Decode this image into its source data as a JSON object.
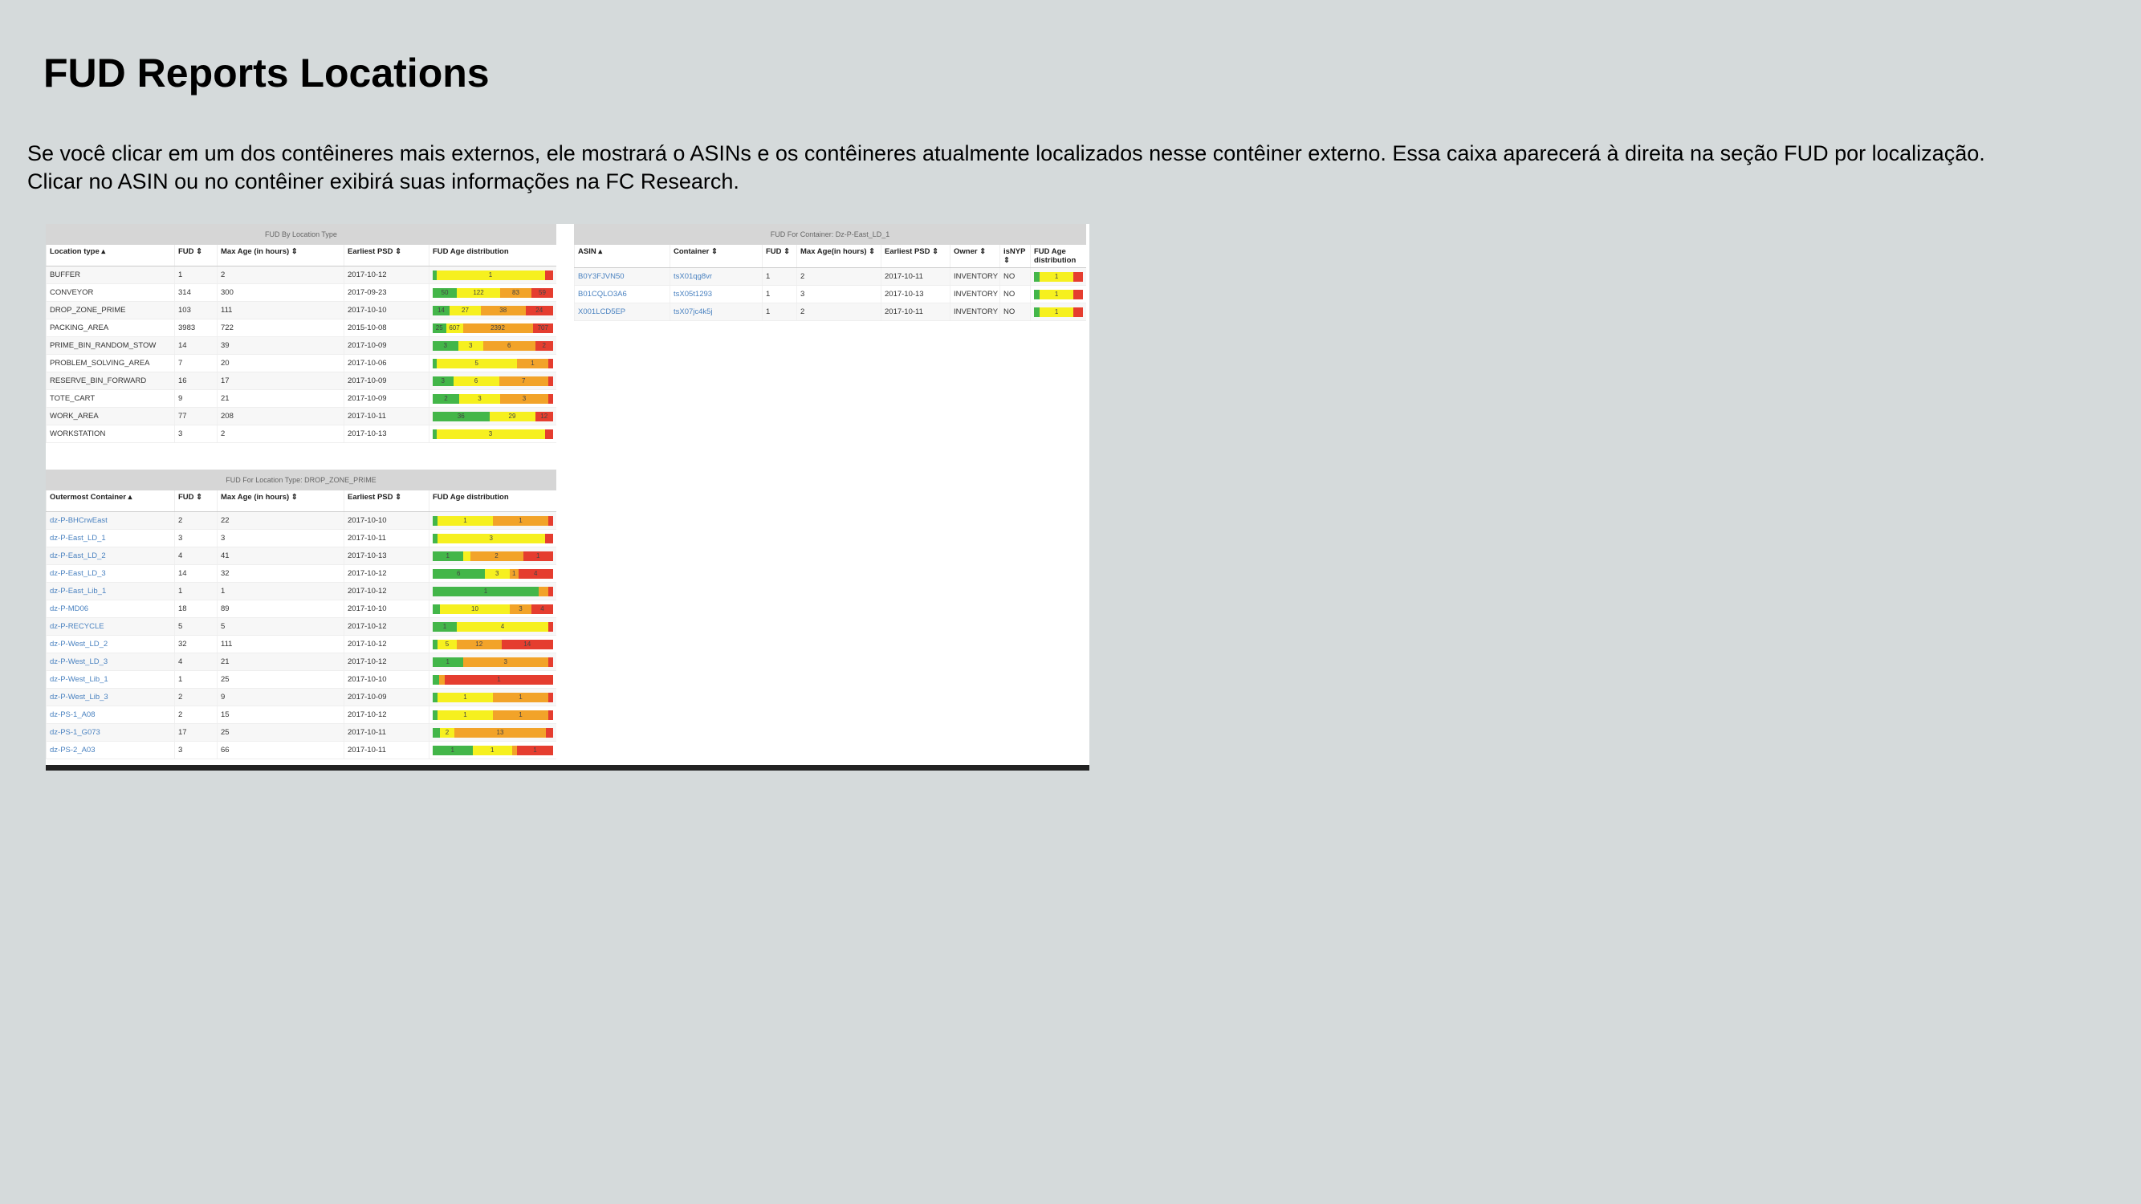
{
  "page": {
    "title": "FUD Reports Locations",
    "description_line1": "Se você clicar em um dos contêineres mais externos, ele mostrará o ASINs e os contêineres atualmente localizados nesse contêiner externo. Essa caixa aparecerá à direita na seção FUD por localização.",
    "description_line2": "Clicar no ASIN ou no contêiner exibirá suas informações na FC Research."
  },
  "colors": {
    "background": "#d5dadb",
    "green": "#43b649",
    "yellow": "#f6f01f",
    "orange": "#f2a329",
    "red": "#e53d2f",
    "link": "#4a82c0"
  },
  "by_location_type": {
    "title": "FUD By Location Type",
    "headers": [
      "Location type ▴",
      "FUD ⇕",
      "Max Age (in hours) ⇕",
      "Earliest PSD ⇕",
      "FUD Age distribution"
    ],
    "rows": [
      {
        "cells": [
          "BUFFER",
          "1",
          "2",
          "2017-10-12"
        ],
        "dist": [
          {
            "c": "g",
            "w": 3,
            "t": ""
          },
          {
            "c": "y",
            "w": 90,
            "t": "1"
          },
          {
            "c": "r",
            "w": 7,
            "t": ""
          }
        ]
      },
      {
        "cells": [
          "CONVEYOR",
          "314",
          "300",
          "2017-09-23"
        ],
        "dist": [
          {
            "c": "g",
            "w": 20,
            "t": "50"
          },
          {
            "c": "y",
            "w": 36,
            "t": "122"
          },
          {
            "c": "o",
            "w": 26,
            "t": "83"
          },
          {
            "c": "r",
            "w": 18,
            "t": "59"
          }
        ]
      },
      {
        "cells": [
          "DROP_ZONE_PRIME",
          "103",
          "111",
          "2017-10-10"
        ],
        "dist": [
          {
            "c": "g",
            "w": 14,
            "t": "14"
          },
          {
            "c": "y",
            "w": 26,
            "t": "27"
          },
          {
            "c": "o",
            "w": 37,
            "t": "38"
          },
          {
            "c": "r",
            "w": 23,
            "t": "24"
          }
        ]
      },
      {
        "cells": [
          "PACKING_AREA",
          "3983",
          "722",
          "2015-10-08"
        ],
        "dist": [
          {
            "c": "g",
            "w": 11,
            "t": "25"
          },
          {
            "c": "y",
            "w": 14,
            "t": "607"
          },
          {
            "c": "o",
            "w": 58,
            "t": "2392"
          },
          {
            "c": "r",
            "w": 17,
            "t": "707"
          }
        ]
      },
      {
        "cells": [
          "PRIME_BIN_RANDOM_STOW",
          "14",
          "39",
          "2017-10-09"
        ],
        "dist": [
          {
            "c": "g",
            "w": 21,
            "t": "3"
          },
          {
            "c": "y",
            "w": 21,
            "t": "3"
          },
          {
            "c": "o",
            "w": 43,
            "t": "6"
          },
          {
            "c": "r",
            "w": 15,
            "t": "2"
          }
        ]
      },
      {
        "cells": [
          "PROBLEM_SOLVING_AREA",
          "7",
          "20",
          "2017-10-06"
        ],
        "dist": [
          {
            "c": "g",
            "w": 3,
            "t": ""
          },
          {
            "c": "y",
            "w": 67,
            "t": "5"
          },
          {
            "c": "o",
            "w": 26,
            "t": "1"
          },
          {
            "c": "r",
            "w": 4,
            "t": ""
          }
        ]
      },
      {
        "cells": [
          "RESERVE_BIN_FORWARD",
          "16",
          "17",
          "2017-10-09"
        ],
        "dist": [
          {
            "c": "g",
            "w": 17,
            "t": "3"
          },
          {
            "c": "y",
            "w": 38,
            "t": "6"
          },
          {
            "c": "o",
            "w": 41,
            "t": "7"
          },
          {
            "c": "r",
            "w": 4,
            "t": ""
          }
        ]
      },
      {
        "cells": [
          "TOTE_CART",
          "9",
          "21",
          "2017-10-09"
        ],
        "dist": [
          {
            "c": "g",
            "w": 22,
            "t": "2"
          },
          {
            "c": "y",
            "w": 34,
            "t": "3"
          },
          {
            "c": "o",
            "w": 40,
            "t": "3"
          },
          {
            "c": "r",
            "w": 4,
            "t": ""
          }
        ]
      },
      {
        "cells": [
          "WORK_AREA",
          "77",
          "208",
          "2017-10-11"
        ],
        "dist": [
          {
            "c": "g",
            "w": 47,
            "t": "36"
          },
          {
            "c": "y",
            "w": 38,
            "t": "29"
          },
          {
            "c": "r",
            "w": 15,
            "t": "12"
          }
        ]
      },
      {
        "cells": [
          "WORKSTATION",
          "3",
          "2",
          "2017-10-13"
        ],
        "dist": [
          {
            "c": "g",
            "w": 3,
            "t": ""
          },
          {
            "c": "y",
            "w": 90,
            "t": "3"
          },
          {
            "c": "r",
            "w": 7,
            "t": ""
          }
        ]
      }
    ]
  },
  "by_container": {
    "title": "FUD For Container: Dz-P-East_LD_1",
    "headers": [
      "ASIN ▴",
      "Container ⇕",
      "FUD ⇕",
      "Max Age(in hours) ⇕",
      "Earliest PSD ⇕",
      "Owner ⇕",
      "isNYP ⇕",
      "FUD Age distribution"
    ],
    "rows": [
      {
        "cells": [
          "B0Y3FJVN50",
          "tsX01qg8vr",
          "1",
          "2",
          "2017-10-11",
          "INVENTORY",
          "NO"
        ],
        "links": [
          0,
          1
        ],
        "dist": [
          {
            "c": "g",
            "w": 12,
            "t": ""
          },
          {
            "c": "y",
            "w": 68,
            "t": "1"
          },
          {
            "c": "r",
            "w": 20,
            "t": ""
          }
        ]
      },
      {
        "cells": [
          "B01CQLO3A6",
          "tsX05t1293",
          "1",
          "3",
          "2017-10-13",
          "INVENTORY",
          "NO"
        ],
        "links": [
          0,
          1
        ],
        "dist": [
          {
            "c": "g",
            "w": 12,
            "t": ""
          },
          {
            "c": "y",
            "w": 68,
            "t": "1"
          },
          {
            "c": "r",
            "w": 20,
            "t": ""
          }
        ]
      },
      {
        "cells": [
          "X001LCD5EP",
          "tsX07jc4k5j",
          "1",
          "2",
          "2017-10-11",
          "INVENTORY",
          "NO"
        ],
        "links": [
          0,
          1
        ],
        "dist": [
          {
            "c": "g",
            "w": 12,
            "t": ""
          },
          {
            "c": "y",
            "w": 68,
            "t": "1"
          },
          {
            "c": "r",
            "w": 20,
            "t": ""
          }
        ]
      }
    ]
  },
  "by_drop_zone": {
    "title": "FUD For Location Type: DROP_ZONE_PRIME",
    "headers": [
      "Outermost Container ▴",
      "FUD ⇕",
      "Max Age (in hours) ⇕",
      "Earliest PSD ⇕",
      "FUD Age distribution"
    ],
    "rows": [
      {
        "cells": [
          "dz-P-BHCrwEast",
          "2",
          "22",
          "2017-10-10"
        ],
        "dist": [
          {
            "c": "g",
            "w": 4,
            "t": ""
          },
          {
            "c": "y",
            "w": 46,
            "t": "1"
          },
          {
            "c": "o",
            "w": 46,
            "t": "1"
          },
          {
            "c": "r",
            "w": 4,
            "t": ""
          }
        ]
      },
      {
        "cells": [
          "dz-P-East_LD_1",
          "3",
          "3",
          "2017-10-11"
        ],
        "dist": [
          {
            "c": "g",
            "w": 4,
            "t": ""
          },
          {
            "c": "y",
            "w": 89,
            "t": "3"
          },
          {
            "c": "r",
            "w": 7,
            "t": ""
          }
        ]
      },
      {
        "cells": [
          "dz-P-East_LD_2",
          "4",
          "41",
          "2017-10-13"
        ],
        "dist": [
          {
            "c": "g",
            "w": 25,
            "t": "1"
          },
          {
            "c": "y",
            "w": 6,
            "t": ""
          },
          {
            "c": "o",
            "w": 44,
            "t": "2"
          },
          {
            "c": "r",
            "w": 25,
            "t": "1"
          }
        ]
      },
      {
        "cells": [
          "dz-P-East_LD_3",
          "14",
          "32",
          "2017-10-12"
        ],
        "dist": [
          {
            "c": "g",
            "w": 43,
            "t": "6"
          },
          {
            "c": "y",
            "w": 21,
            "t": "3"
          },
          {
            "c": "o",
            "w": 7,
            "t": "1"
          },
          {
            "c": "r",
            "w": 29,
            "t": "4"
          }
        ]
      },
      {
        "cells": [
          "dz-P-East_Lib_1",
          "1",
          "1",
          "2017-10-12"
        ],
        "dist": [
          {
            "c": "g",
            "w": 88,
            "t": "1"
          },
          {
            "c": "o",
            "w": 8,
            "t": ""
          },
          {
            "c": "r",
            "w": 4,
            "t": ""
          }
        ]
      },
      {
        "cells": [
          "dz-P-MD06",
          "18",
          "89",
          "2017-10-10"
        ],
        "dist": [
          {
            "c": "g",
            "w": 6,
            "t": ""
          },
          {
            "c": "y",
            "w": 58,
            "t": "10"
          },
          {
            "c": "o",
            "w": 18,
            "t": "3"
          },
          {
            "c": "r",
            "w": 18,
            "t": "4"
          }
        ]
      },
      {
        "cells": [
          "dz-P-RECYCLE",
          "5",
          "5",
          "2017-10-12"
        ],
        "dist": [
          {
            "c": "g",
            "w": 20,
            "t": "1"
          },
          {
            "c": "y",
            "w": 76,
            "t": "4"
          },
          {
            "c": "r",
            "w": 4,
            "t": ""
          }
        ]
      },
      {
        "cells": [
          "dz-P-West_LD_2",
          "32",
          "111",
          "2017-10-12"
        ],
        "dist": [
          {
            "c": "g",
            "w": 4,
            "t": ""
          },
          {
            "c": "y",
            "w": 16,
            "t": "5"
          },
          {
            "c": "o",
            "w": 37,
            "t": "12"
          },
          {
            "c": "r",
            "w": 43,
            "t": "14"
          }
        ]
      },
      {
        "cells": [
          "dz-P-West_LD_3",
          "4",
          "21",
          "2017-10-12"
        ],
        "dist": [
          {
            "c": "g",
            "w": 25,
            "t": "1"
          },
          {
            "c": "o",
            "w": 71,
            "t": "3"
          },
          {
            "c": "r",
            "w": 4,
            "t": ""
          }
        ]
      },
      {
        "cells": [
          "dz-P-West_Lib_1",
          "1",
          "25",
          "2017-10-10"
        ],
        "dist": [
          {
            "c": "g",
            "w": 5,
            "t": ""
          },
          {
            "c": "o",
            "w": 5,
            "t": ""
          },
          {
            "c": "r",
            "w": 90,
            "t": "1"
          }
        ]
      },
      {
        "cells": [
          "dz-P-West_Lib_3",
          "2",
          "9",
          "2017-10-09"
        ],
        "dist": [
          {
            "c": "g",
            "w": 4,
            "t": ""
          },
          {
            "c": "y",
            "w": 46,
            "t": "1"
          },
          {
            "c": "o",
            "w": 46,
            "t": "1"
          },
          {
            "c": "r",
            "w": 4,
            "t": ""
          }
        ]
      },
      {
        "cells": [
          "dz-PS-1_A08",
          "2",
          "15",
          "2017-10-12"
        ],
        "dist": [
          {
            "c": "g",
            "w": 4,
            "t": ""
          },
          {
            "c": "y",
            "w": 46,
            "t": "1"
          },
          {
            "c": "o",
            "w": 46,
            "t": "1"
          },
          {
            "c": "r",
            "w": 4,
            "t": ""
          }
        ]
      },
      {
        "cells": [
          "dz-PS-1_G073",
          "17",
          "25",
          "2017-10-11"
        ],
        "dist": [
          {
            "c": "g",
            "w": 6,
            "t": ""
          },
          {
            "c": "y",
            "w": 12,
            "t": "2"
          },
          {
            "c": "o",
            "w": 76,
            "t": "13"
          },
          {
            "c": "r",
            "w": 6,
            "t": ""
          }
        ]
      },
      {
        "cells": [
          "dz-PS-2_A03",
          "3",
          "66",
          "2017-10-11"
        ],
        "dist": [
          {
            "c": "g",
            "w": 33,
            "t": "1"
          },
          {
            "c": "y",
            "w": 33,
            "t": "1"
          },
          {
            "c": "o",
            "w": 4,
            "t": ""
          },
          {
            "c": "r",
            "w": 30,
            "t": "1"
          }
        ]
      }
    ]
  }
}
